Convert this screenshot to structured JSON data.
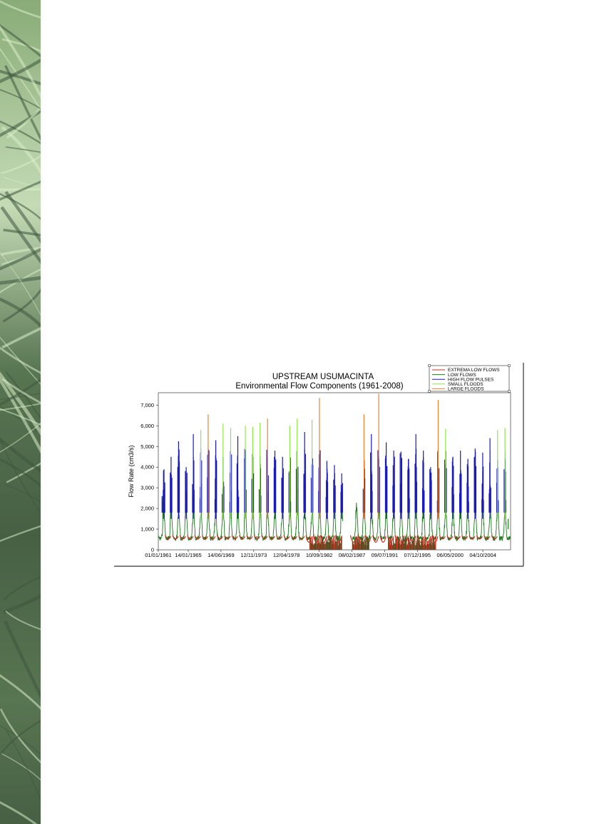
{
  "background": {
    "leaf_strip_colors": [
      "#1f3d1c",
      "#6f9a5a",
      "#b8d3a6",
      "#34582c"
    ]
  },
  "chart_data": {
    "type": "line",
    "title": "UPSTREAM USUMACINTA",
    "subtitle": "Environmental Flow Components (1961-2008)",
    "xlabel": "",
    "ylabel": "Flow Rate (cm3/s)",
    "x_range": [
      "1961-01-01",
      "2008-06-30"
    ],
    "ylim": [
      0,
      7600
    ],
    "y_ticks": [
      0,
      1000,
      2000,
      3000,
      4000,
      5000,
      6000,
      7000
    ],
    "y_tick_labels": [
      "0",
      "1,000",
      "2,000",
      "3,000",
      "4,000",
      "5,000",
      "6,000",
      "7,000"
    ],
    "x_tick_labels": [
      "01/01/1961",
      "14/01/1965",
      "14/06/1969",
      "12/11/1973",
      "12/04/1978",
      "10/09/1982",
      "08/02/1987",
      "09/07/1991",
      "07/12/1995",
      "06/05/2000",
      "04/10/2004"
    ],
    "x_tick_dates": [
      "1961-01-01",
      "1965-01-14",
      "1969-06-14",
      "1973-11-12",
      "1978-04-12",
      "1982-09-10",
      "1987-02-08",
      "1991-07-09",
      "1995-12-07",
      "2000-05-06",
      "2004-10-04"
    ],
    "grid": false,
    "legend_position": "top-right",
    "series": [
      {
        "name": "EXTREMA LOW FLOWS",
        "color": "#e0241c"
      },
      {
        "name": "LOW FLOWS",
        "color": "#1e7a1e"
      },
      {
        "name": "HIGH FLOW PULSES",
        "color": "#1a1ab8"
      },
      {
        "name": "SMALL FLOODS",
        "color": "#8fe84a"
      },
      {
        "name": "LARGE FLOODS",
        "color": "#f08030"
      }
    ],
    "annual_peaks": [
      {
        "date": "1961-08-15",
        "value": 2600,
        "component": "LOW FLOWS"
      },
      {
        "date": "1961-10-10",
        "value": 3900,
        "component": "HIGH FLOW PULSES"
      },
      {
        "date": "1962-09-20",
        "value": 4500,
        "component": "HIGH FLOW PULSES"
      },
      {
        "date": "1963-09-25",
        "value": 5250,
        "component": "HIGH FLOW PULSES"
      },
      {
        "date": "1964-10-05",
        "value": 4000,
        "component": "HIGH FLOW PULSES"
      },
      {
        "date": "1965-09-20",
        "value": 5600,
        "component": "HIGH FLOW PULSES"
      },
      {
        "date": "1966-09-25",
        "value": 5800,
        "component": "SMALL FLOODS"
      },
      {
        "date": "1967-09-20",
        "value": 6550,
        "component": "LARGE FLOODS"
      },
      {
        "date": "1968-10-01",
        "value": 5300,
        "component": "HIGH FLOW PULSES"
      },
      {
        "date": "1969-09-25",
        "value": 6100,
        "component": "SMALL FLOODS"
      },
      {
        "date": "1970-10-05",
        "value": 5900,
        "component": "SMALL FLOODS"
      },
      {
        "date": "1971-09-20",
        "value": 5500,
        "component": "HIGH FLOW PULSES"
      },
      {
        "date": "1972-09-25",
        "value": 6000,
        "component": "SMALL FLOODS"
      },
      {
        "date": "1973-09-25",
        "value": 5950,
        "component": "SMALL FLOODS"
      },
      {
        "date": "1974-09-20",
        "value": 6150,
        "component": "SMALL FLOODS"
      },
      {
        "date": "1975-09-25",
        "value": 6350,
        "component": "LARGE FLOODS"
      },
      {
        "date": "1976-09-20",
        "value": 4800,
        "component": "HIGH FLOW PULSES"
      },
      {
        "date": "1977-10-01",
        "value": 4500,
        "component": "HIGH FLOW PULSES"
      },
      {
        "date": "1978-09-25",
        "value": 6000,
        "component": "SMALL FLOODS"
      },
      {
        "date": "1979-09-20",
        "value": 6350,
        "component": "SMALL FLOODS"
      },
      {
        "date": "1980-09-25",
        "value": 5700,
        "component": "HIGH FLOW PULSES"
      },
      {
        "date": "1981-09-25",
        "value": 6300,
        "component": "SMALL FLOODS"
      },
      {
        "date": "1982-09-20",
        "value": 7350,
        "component": "LARGE FLOODS"
      },
      {
        "date": "1983-09-25",
        "value": 4300,
        "component": "HIGH FLOW PULSES"
      },
      {
        "date": "1984-10-01",
        "value": 4100,
        "component": "HIGH FLOW PULSES"
      },
      {
        "date": "1985-09-25",
        "value": 3700,
        "component": "HIGH FLOW PULSES"
      },
      {
        "date": "1987-08-20",
        "value": 1900,
        "component": "LOW FLOWS"
      },
      {
        "date": "1988-09-25",
        "value": 6550,
        "component": "LARGE FLOODS"
      },
      {
        "date": "1989-09-25",
        "value": 5600,
        "component": "HIGH FLOW PULSES"
      },
      {
        "date": "1990-09-20",
        "value": 7550,
        "component": "LARGE FLOODS"
      },
      {
        "date": "1991-09-25",
        "value": 5200,
        "component": "HIGH FLOW PULSES"
      },
      {
        "date": "1992-09-25",
        "value": 4800,
        "component": "HIGH FLOW PULSES"
      },
      {
        "date": "1993-09-20",
        "value": 4750,
        "component": "HIGH FLOW PULSES"
      },
      {
        "date": "1994-10-01",
        "value": 4400,
        "component": "HIGH FLOW PULSES"
      },
      {
        "date": "1995-09-25",
        "value": 5600,
        "component": "HIGH FLOW PULSES"
      },
      {
        "date": "1996-09-25",
        "value": 4800,
        "component": "HIGH FLOW PULSES"
      },
      {
        "date": "1997-09-20",
        "value": 4000,
        "component": "HIGH FLOW PULSES"
      },
      {
        "date": "1998-09-25",
        "value": 7250,
        "component": "LARGE FLOODS"
      },
      {
        "date": "1999-09-25",
        "value": 5850,
        "component": "SMALL FLOODS"
      },
      {
        "date": "2000-09-20",
        "value": 4500,
        "component": "HIGH FLOW PULSES"
      },
      {
        "date": "2001-09-25",
        "value": 4800,
        "component": "HIGH FLOW PULSES"
      },
      {
        "date": "2002-09-25",
        "value": 4400,
        "component": "HIGH FLOW PULSES"
      },
      {
        "date": "2003-09-20",
        "value": 4900,
        "component": "HIGH FLOW PULSES"
      },
      {
        "date": "2004-09-25",
        "value": 4700,
        "component": "HIGH FLOW PULSES"
      },
      {
        "date": "2005-09-20",
        "value": 5400,
        "component": "HIGH FLOW PULSES"
      },
      {
        "date": "2006-09-25",
        "value": 5800,
        "component": "SMALL FLOODS"
      },
      {
        "date": "2007-09-25",
        "value": 5900,
        "component": "SMALL FLOODS"
      },
      {
        "date": "2008-03-01",
        "value": 1000,
        "component": "LOW FLOWS"
      }
    ]
  }
}
